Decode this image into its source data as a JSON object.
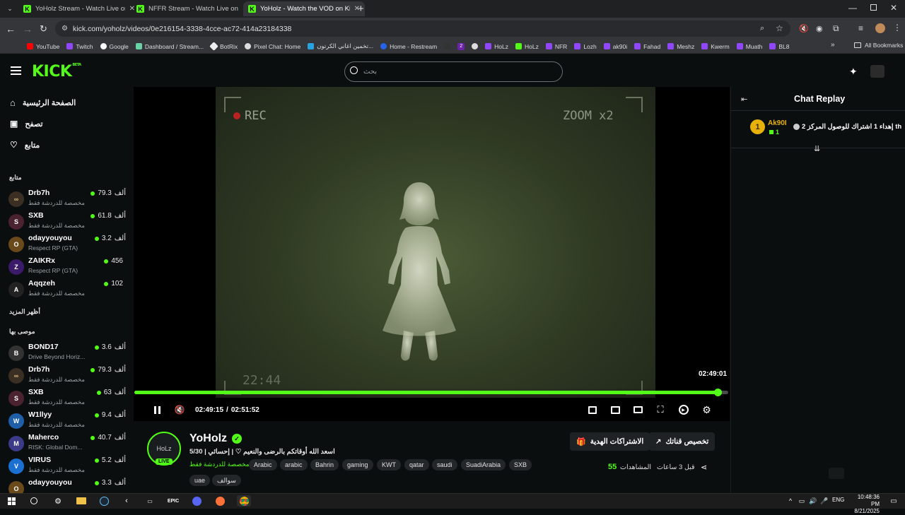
{
  "browser": {
    "tabs": [
      {
        "title": "YoHolz Stream - Watch Live on Kick",
        "active": false
      },
      {
        "title": "NFFR Stream - Watch Live on Kick",
        "active": false
      },
      {
        "title": "YoHolz - Watch the VOD on Kick",
        "active": true
      }
    ],
    "url": "kick.com/yoholz/videos/0e216154-3338-4cce-ac72-414a23184338",
    "bookmarks": [
      "YouTube",
      "Twitch",
      "Google",
      "Dashboard / Stream...",
      "BotRix",
      "Pixel Chat: Home",
      "تخمين اغاني الكرتون...",
      "Home - Restream",
      "2",
      "",
      "HoLz",
      "HoLz",
      "NFR",
      "Lozh",
      "ak90i",
      "Fahad",
      "Meshz",
      "Kwerm",
      "Muath",
      "BL8"
    ],
    "all_bookmarks": "All Bookmarks"
  },
  "header": {
    "logo": "KICK",
    "logo_beta": "BETA",
    "search_placeholder": "بحث"
  },
  "sidebar": {
    "nav": [
      {
        "label": "الصفحة الرئيسية",
        "icon": "home-icon"
      },
      {
        "label": "تصفح",
        "icon": "browse-icon"
      },
      {
        "label": "متابع",
        "icon": "heart-icon"
      }
    ],
    "following_title": "متابع",
    "following": [
      {
        "name": "Drb7h",
        "sub": "مخصصة للدردشة فقط",
        "viewers": "79.3",
        "unit": "ألف",
        "av": "∞"
      },
      {
        "name": "SXB",
        "sub": "مخصصة للدردشة فقط",
        "viewers": "61.8",
        "unit": "ألف",
        "av": "S"
      },
      {
        "name": "odayyouyou",
        "sub": "Respect RP (GTA)",
        "viewers": "3.2",
        "unit": "ألف",
        "av": "O"
      },
      {
        "name": "ZAIKRx",
        "sub": "Respect RP (GTA)",
        "viewers": "456",
        "unit": "",
        "av": "Z"
      },
      {
        "name": "Aqqzeh",
        "sub": "مخصصة للدردشة فقط",
        "viewers": "102",
        "unit": "",
        "av": "A"
      }
    ],
    "show_more": "أظهر المزيد",
    "recommended_title": "موصى بها",
    "recommended": [
      {
        "name": "BOND17",
        "sub": "Drive Beyond Horiz...",
        "viewers": "3.6",
        "unit": "ألف",
        "av": "B"
      },
      {
        "name": "Drb7h",
        "sub": "مخصصة للدردشة فقط",
        "viewers": "79.3",
        "unit": "ألف",
        "av": "∞"
      },
      {
        "name": "SXB",
        "sub": "مخصصة للدردشة فقط",
        "viewers": "63",
        "unit": "ألف",
        "av": "S"
      },
      {
        "name": "W1llyy",
        "sub": "مخصصة للدردشة فقط",
        "viewers": "9.4",
        "unit": "ألف",
        "av": "W"
      },
      {
        "name": "Maherco",
        "sub": "RISK: Global Dom...",
        "viewers": "40.7",
        "unit": "ألف",
        "av": "M"
      },
      {
        "name": "VIRUS",
        "sub": "مخصصة للدردشة فقط",
        "viewers": "5.2",
        "unit": "ألف",
        "av": "V"
      },
      {
        "name": "odayyouyou",
        "sub": "",
        "viewers": "3.3",
        "unit": "ألف",
        "av": "O"
      }
    ]
  },
  "video": {
    "overlay_rec": "REC",
    "overlay_zoom": "ZOOM x2",
    "overlay_clock": "22:44",
    "hover_time": "02:49:01",
    "current_time": "02:49:15",
    "separator": "/",
    "duration": "02:51:52",
    "progress": 0.9825
  },
  "stream": {
    "channel": "YoHolz",
    "live_badge": "LIVE",
    "title": "اسعد الله أوقاتكم بالرضى والنعيم ♡ | إحسائي | 5/30",
    "category": "مخصصة للدردشة فقط",
    "tags": [
      "Arabic",
      "arabic",
      "Bahrin",
      "gaming",
      "KWT",
      "qatar",
      "saudi",
      "SuadiArabia",
      "SXB",
      "uae",
      "سوالف"
    ],
    "gift_button": "الاشتراكات الهدية",
    "customize_button": "تخصيص قناتك",
    "views_value": "55",
    "views_label": "المشاهدات",
    "time_ago": "قبل 3 ساعات"
  },
  "chat": {
    "title": "Chat Replay",
    "messages": [
      {
        "user": "Ak90I",
        "badge": "1",
        "sub_count": "1",
        "text": "إهداء 1 اشتراك للوصول المركز 2 th"
      }
    ]
  },
  "taskbar": {
    "lang": "ENG",
    "time": "10:48:36 PM",
    "date": "8/21/2025"
  },
  "colors": {
    "accent": "#53fc18",
    "bg": "#0b0e0f"
  }
}
